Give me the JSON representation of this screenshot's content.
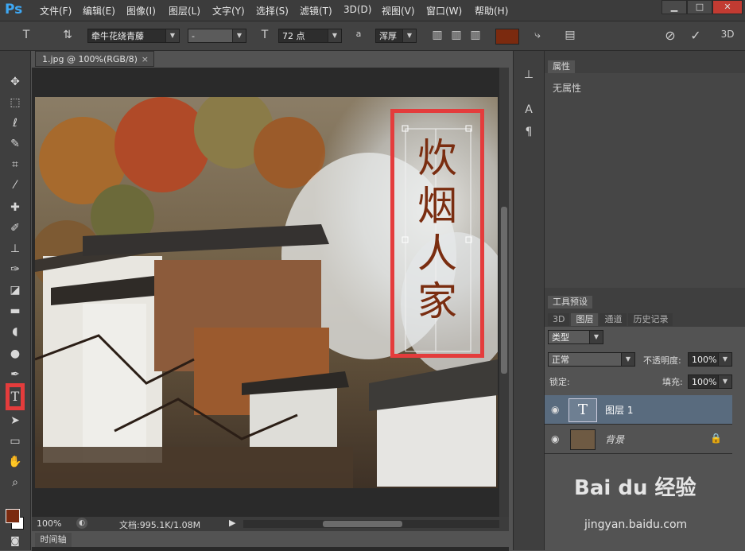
{
  "app": {
    "logo": "Ps"
  },
  "menu": [
    "文件(F)",
    "编辑(E)",
    "图像(I)",
    "图层(L)",
    "文字(Y)",
    "选择(S)",
    "滤镜(T)",
    "3D(D)",
    "视图(V)",
    "窗口(W)",
    "帮助(H)"
  ],
  "window_controls": {
    "minimize": "▁",
    "restore": "□",
    "close": "✕"
  },
  "options": {
    "font_family": "牵牛花绕青藤",
    "font_style": "-",
    "font_size": "72 点",
    "aa_label": "a",
    "anti_alias": "浑厚",
    "text_color": "#7b2a0f"
  },
  "document": {
    "tab_title": "1.jpg @ 100%(RGB/8)",
    "zoom": "100%",
    "doc_info": "文档:995.1K/1.08M"
  },
  "canvas_text": {
    "chars": [
      "炊",
      "烟",
      "人",
      "家"
    ],
    "color": "#7a2d10"
  },
  "timeline": {
    "label": "时间轴"
  },
  "properties": {
    "tab": "属性",
    "content": "无属性"
  },
  "tool_presets": {
    "tab": "工具预设"
  },
  "layers_panel": {
    "tabs": [
      "3D",
      "图层",
      "通道",
      "历史记录"
    ],
    "active_tab": "图层",
    "filter": "类型",
    "blend_mode": "正常",
    "opacity_label": "不透明度:",
    "opacity": "100%",
    "lock_label": "锁定:",
    "fill_label": "填充:",
    "fill": "100%",
    "layers": [
      {
        "name": "图层 1",
        "type": "text",
        "selected": true
      },
      {
        "name": "背景",
        "type": "image",
        "selected": false,
        "locked": true
      }
    ]
  },
  "watermark": {
    "brand": "Bai du 经验",
    "url": "jingyan.baidu.com"
  },
  "colors": {
    "accent_red": "#e43c3c",
    "text_fill": "#7a2d10",
    "ps_blue": "#3ea8f4"
  }
}
